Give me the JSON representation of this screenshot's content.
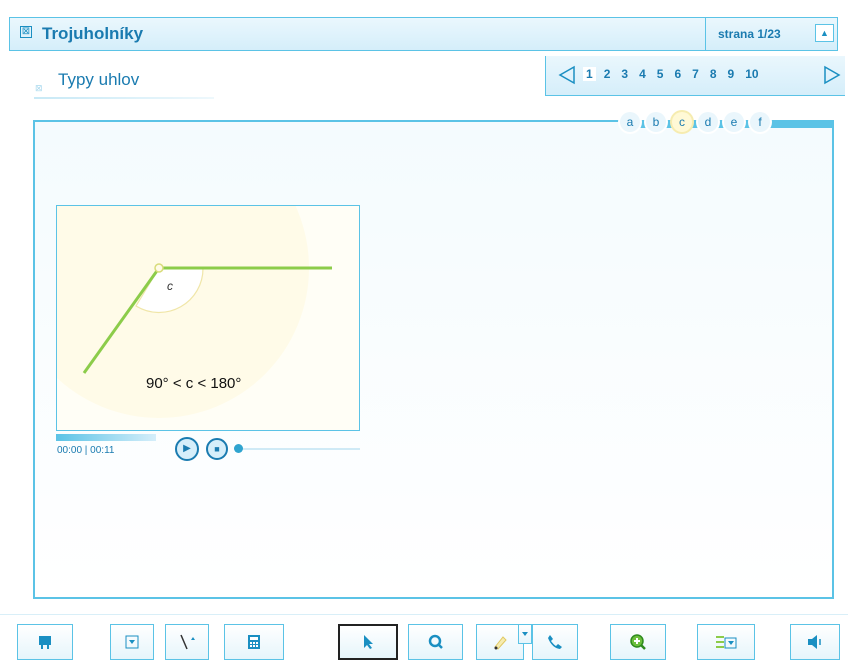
{
  "header": {
    "close_glyph": "⊠",
    "title": "Trojuholníky",
    "page_indicator": "strana  1/23",
    "scroll_up_glyph": "▲"
  },
  "subheader": {
    "icon_glyph": "⊠",
    "title": "Typy uhlov"
  },
  "pagination": {
    "pages": [
      "1",
      "2",
      "3",
      "4",
      "5",
      "6",
      "7",
      "8",
      "9",
      "10"
    ],
    "current": "1"
  },
  "subtabs": {
    "items": [
      "a",
      "b",
      "c",
      "d",
      "e",
      "f"
    ],
    "active": "c"
  },
  "animation": {
    "angle_label": "c",
    "formula": "90° < c < 180°"
  },
  "media": {
    "time": "00:00 | 00:11",
    "play_glyph": "▶",
    "stop_glyph": "■"
  },
  "toolbar": {
    "icons": [
      "chat-icon",
      "dropdown-icon",
      "line-tool-icon",
      "calculator-icon",
      "pointer-icon",
      "magnifier-icon",
      "highlighter-icon",
      "dropdown-icon",
      "phone-icon",
      "zoom-in-icon",
      "dropdown-icon",
      "list-icon",
      "speaker-icon"
    ]
  },
  "colors": {
    "accent": "#5bc3e6",
    "text_blue": "#1a7bb0",
    "angle_line": "#8ccc4a",
    "highlight": "#f6ecb0"
  }
}
